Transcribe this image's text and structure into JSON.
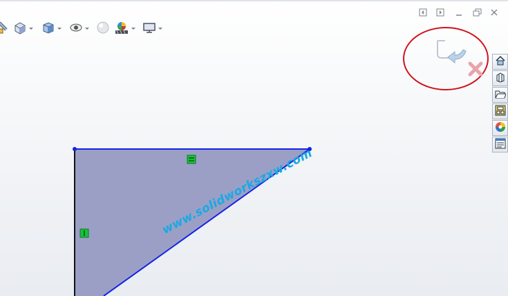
{
  "toolbar": {
    "items": [
      "sketch-tools-icon",
      "view-orientation-icon",
      "display-style-icon",
      "hide-show-icon",
      "edit-appearance-icon",
      "apply-scene-icon",
      "view-settings-icon"
    ]
  },
  "window_controls": [
    "tile-left-icon",
    "tile-right-icon",
    "minimize-icon",
    "restore-icon",
    "close-icon"
  ],
  "confirmation_corner": {
    "items": [
      "exit-sketch-icon",
      "cancel-sketch-icon"
    ],
    "highlight_color": "#d0121b"
  },
  "task_pane": {
    "items": [
      "home-icon",
      "design-library-icon",
      "file-explorer-icon",
      "view-palette-icon",
      "appearances-icon",
      "custom-properties-icon"
    ]
  },
  "sketch": {
    "fill_color": "#9b9fc6",
    "line_color": "#1422e6",
    "relation_color": "#18c23a"
  },
  "watermark": {
    "text": "www.solidworkszxw.com",
    "color": "#1aa9e3"
  }
}
